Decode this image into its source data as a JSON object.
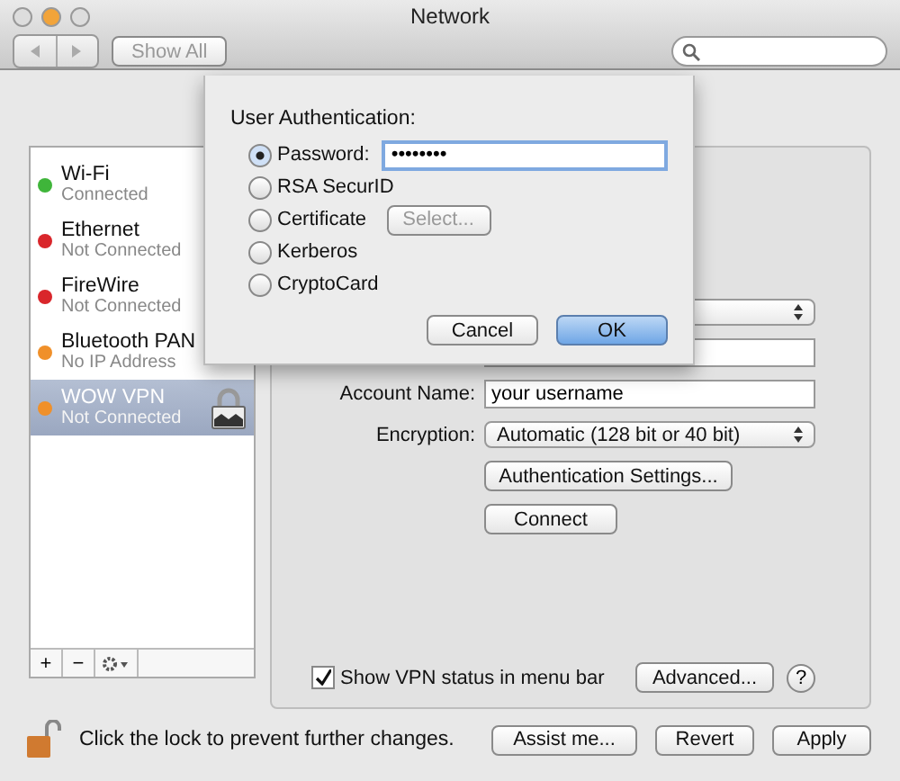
{
  "window": {
    "title": "Network"
  },
  "toolbar": {
    "show_all": "Show All"
  },
  "sidebar": {
    "items": [
      {
        "name": "Wi-Fi",
        "status": "Connected",
        "color": "#3fb53a",
        "selected": false,
        "locked": false
      },
      {
        "name": "Ethernet",
        "status": "Not Connected",
        "color": "#d9262b",
        "selected": false,
        "locked": false
      },
      {
        "name": "FireWire",
        "status": "Not Connected",
        "color": "#d9262b",
        "selected": false,
        "locked": false
      },
      {
        "name": "Bluetooth PAN",
        "status": "No IP Address",
        "color": "#f0902a",
        "selected": false,
        "locked": false
      },
      {
        "name": "WOW VPN",
        "status": "Not Connected",
        "color": "#f0902a",
        "selected": true,
        "locked": true
      }
    ],
    "add": "+",
    "remove": "−"
  },
  "form": {
    "account_name": {
      "label": "Account Name:",
      "value": "your username"
    },
    "encryption": {
      "label": "Encryption:",
      "value": "Automatic (128 bit or 40 bit)"
    },
    "auth_button": "Authentication Settings...",
    "connect_button": "Connect",
    "show_status": {
      "label": "Show VPN status in menu bar",
      "checked": true
    },
    "advanced_button": "Advanced...",
    "help": "?"
  },
  "sheet": {
    "title": "User Authentication:",
    "options": [
      {
        "label": "Password:",
        "selected": true,
        "kind": "field",
        "value": "••••••••"
      },
      {
        "label": "RSA SecurID",
        "selected": false,
        "kind": "plain"
      },
      {
        "label": "Certificate",
        "selected": false,
        "kind": "button",
        "button": "Select...",
        "disabled": true
      },
      {
        "label": "Kerberos",
        "selected": false,
        "kind": "plain"
      },
      {
        "label": "CryptoCard",
        "selected": false,
        "kind": "plain"
      }
    ],
    "cancel": "Cancel",
    "ok": "OK"
  },
  "footer": {
    "lock_text": "Click the lock to prevent further changes.",
    "buttons": [
      "Assist me...",
      "Revert",
      "Apply"
    ]
  }
}
